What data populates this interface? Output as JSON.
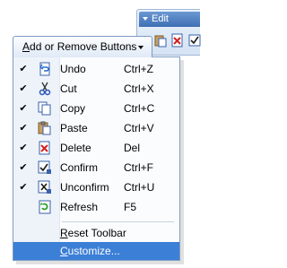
{
  "toolbar": {
    "title": "Edit",
    "buttons": [
      "paste-icon",
      "delete-icon",
      "confirm-icon"
    ]
  },
  "header": {
    "label_underlined": "A",
    "label_rest": "dd or Remove Buttons"
  },
  "menu": {
    "items": [
      {
        "label": "Undo",
        "shortcut": "Ctrl+Z",
        "checked": true,
        "icon": "undo-icon"
      },
      {
        "label": "Cut",
        "shortcut": "Ctrl+X",
        "checked": true,
        "icon": "cut-icon"
      },
      {
        "label": "Copy",
        "shortcut": "Ctrl+C",
        "checked": true,
        "icon": "copy-icon"
      },
      {
        "label": "Paste",
        "shortcut": "Ctrl+V",
        "checked": true,
        "icon": "paste-icon"
      },
      {
        "label": "Delete",
        "shortcut": "Del",
        "checked": true,
        "icon": "delete-icon"
      },
      {
        "label": "Confirm",
        "shortcut": "Ctrl+F",
        "checked": true,
        "icon": "confirm-icon"
      },
      {
        "label": "Unconfirm",
        "shortcut": "Ctrl+U",
        "checked": true,
        "icon": "unconfirm-icon"
      },
      {
        "label": "Refresh",
        "shortcut": "F5",
        "checked": false,
        "icon": "refresh-icon"
      }
    ],
    "check_glyph": "✔",
    "reset": {
      "underlined": "R",
      "rest": "eset Toolbar"
    },
    "customize": {
      "underlined": "C",
      "rest": "ustomize..."
    }
  },
  "colors": {
    "accent": "#3c7fd6",
    "border": "#7d9cc2"
  }
}
